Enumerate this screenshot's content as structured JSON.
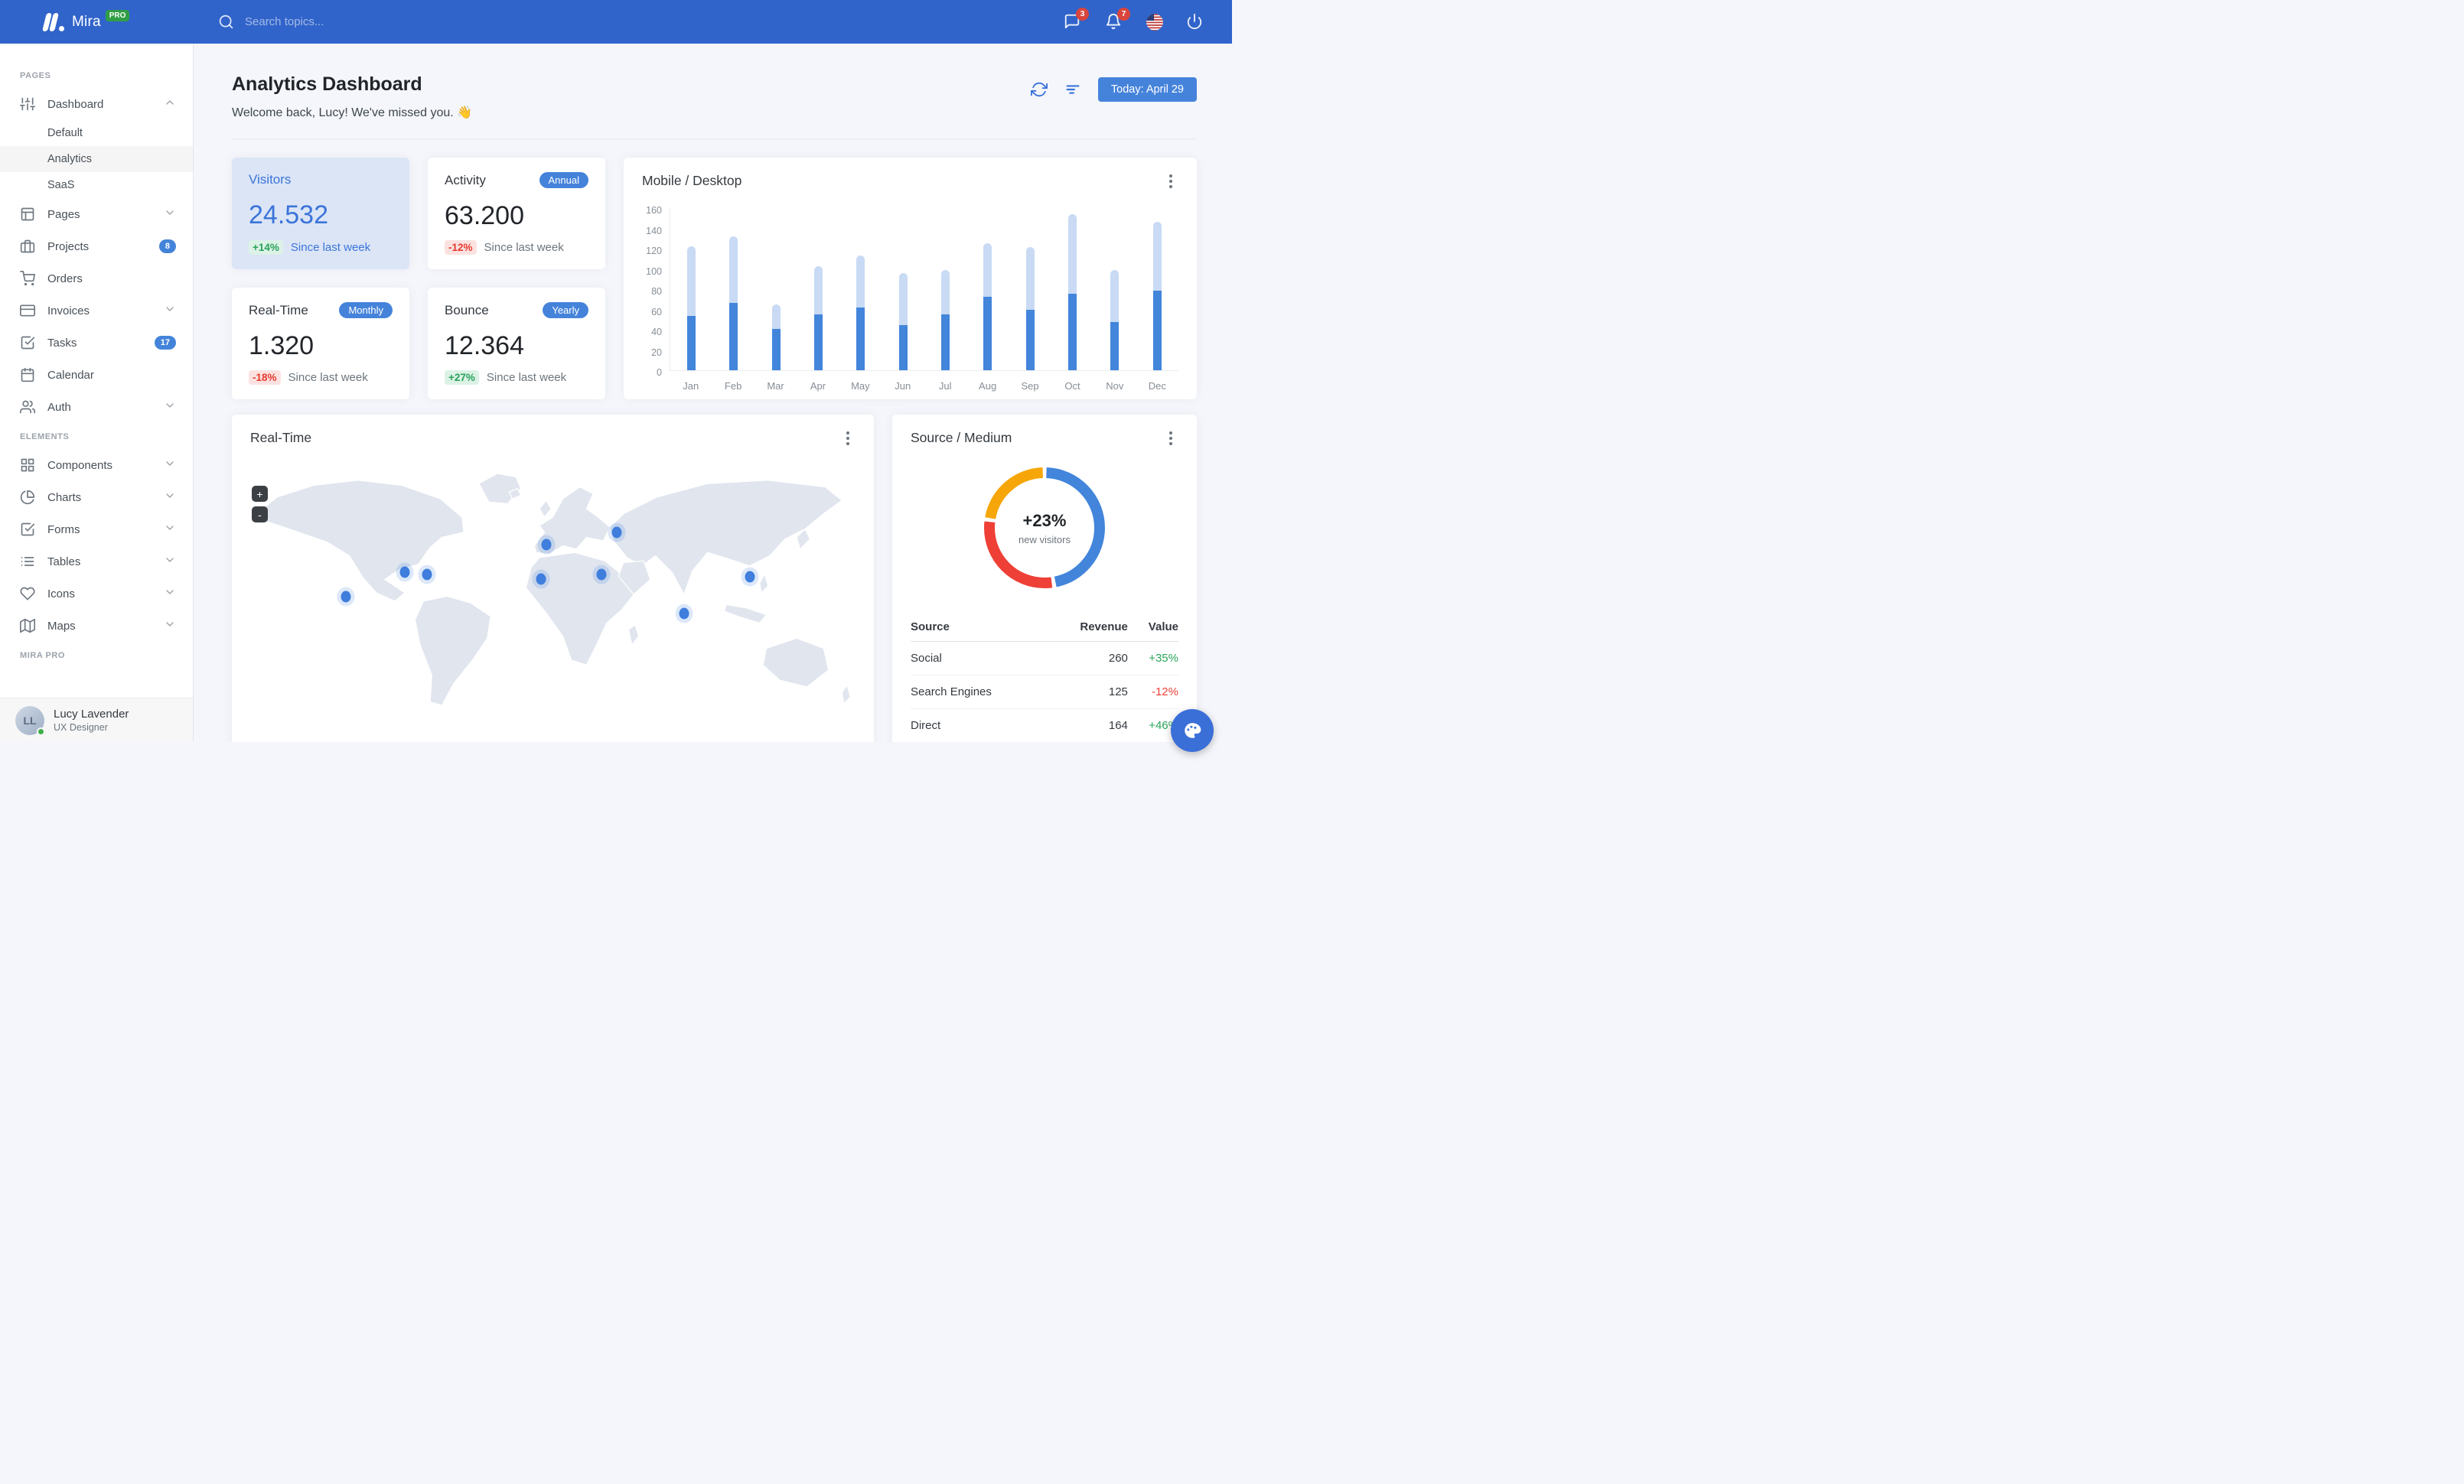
{
  "navbar": {
    "brand": "Mira",
    "brand_badge": "PRO",
    "search_placeholder": "Search topics...",
    "messages_badge": "3",
    "notifications_badge": "7"
  },
  "sidebar": {
    "sections": [
      {
        "header": "PAGES",
        "items": [
          {
            "label": "Dashboard"
          },
          {
            "label": "Default"
          },
          {
            "label": "Analytics"
          },
          {
            "label": "SaaS"
          },
          {
            "label": "Pages"
          },
          {
            "label": "Projects",
            "badge": "8"
          },
          {
            "label": "Orders"
          },
          {
            "label": "Invoices"
          },
          {
            "label": "Tasks",
            "badge": "17"
          },
          {
            "label": "Calendar"
          },
          {
            "label": "Auth"
          }
        ]
      },
      {
        "header": "ELEMENTS",
        "items": [
          {
            "label": "Components"
          },
          {
            "label": "Charts"
          },
          {
            "label": "Forms"
          },
          {
            "label": "Tables"
          },
          {
            "label": "Icons"
          },
          {
            "label": "Maps"
          }
        ]
      },
      {
        "header": "MIRA PRO",
        "items": []
      }
    ],
    "user": {
      "name": "Lucy Lavender",
      "role": "UX Designer",
      "initials": "LL"
    }
  },
  "header": {
    "title": "Analytics Dashboard",
    "subtitle": "Welcome back, Lucy! We've missed you. 👋",
    "date_button": "Today: April 29"
  },
  "stats": [
    {
      "title": "Visitors",
      "value": "24.532",
      "delta": "+14%",
      "note": "Since last week"
    },
    {
      "title": "Activity",
      "value": "63.200",
      "delta": "-12%",
      "note": "Since last week",
      "badge": "Annual"
    },
    {
      "title": "Real-Time",
      "value": "1.320",
      "delta": "-18%",
      "note": "Since last week",
      "badge": "Monthly"
    },
    {
      "title": "Bounce",
      "value": "12.364",
      "delta": "+27%",
      "note": "Since last week",
      "badge": "Yearly"
    }
  ],
  "chart_data": [
    {
      "type": "bar",
      "title": "Mobile / Desktop",
      "stacked": true,
      "categories": [
        "Jan",
        "Feb",
        "Mar",
        "Apr",
        "May",
        "Jun",
        "Jul",
        "Aug",
        "Sep",
        "Oct",
        "Nov",
        "Dec"
      ],
      "series": [
        {
          "name": "Mobile",
          "color": "#4285db",
          "values": [
            54,
            67,
            41,
            55,
            62,
            45,
            55,
            73,
            60,
            76,
            48,
            79
          ]
        },
        {
          "name": "Desktop",
          "color": "#c9daf4",
          "values": [
            69,
            66,
            24,
            48,
            52,
            51,
            44,
            53,
            62,
            79,
            51,
            68
          ]
        }
      ],
      "xlabel": "",
      "ylabel": "",
      "ylim": [
        0,
        160
      ],
      "ytick_step": 20,
      "grid": false,
      "legend": "none"
    },
    {
      "type": "donut",
      "title": "Source / Medium",
      "center_value": "+23%",
      "center_label": "new visitors",
      "slices": [
        {
          "label": "Social",
          "value": 260,
          "color": "#4285db"
        },
        {
          "label": "Direct",
          "value": 164,
          "color": "#ee4037"
        },
        {
          "label": "Search Engines",
          "value": 125,
          "color": "#f6a609"
        }
      ]
    }
  ],
  "map_card": {
    "title": "Real-Time",
    "zoom_in": "+",
    "zoom_out": "-",
    "markers": [
      {
        "city": "San Francisco",
        "x": 57,
        "y": 57
      },
      {
        "city": "Chicago",
        "x": 92,
        "y": 47
      },
      {
        "city": "New York",
        "x": 105,
        "y": 48
      },
      {
        "city": "London",
        "x": 176,
        "y": 36
      },
      {
        "city": "Madrid",
        "x": 173,
        "y": 50
      },
      {
        "city": "Moscow",
        "x": 218,
        "y": 31
      },
      {
        "city": "Istanbul",
        "x": 209,
        "y": 48
      },
      {
        "city": "Delhi",
        "x": 258,
        "y": 64
      },
      {
        "city": "Beijing",
        "x": 297,
        "y": 49
      }
    ]
  },
  "source_table": {
    "columns": [
      "Source",
      "Revenue",
      "Value"
    ],
    "rows": [
      {
        "source": "Social",
        "revenue": "260",
        "value": "+35%",
        "trend": "up"
      },
      {
        "source": "Search Engines",
        "revenue": "125",
        "value": "-12%",
        "trend": "down"
      },
      {
        "source": "Direct",
        "revenue": "164",
        "value": "+46%",
        "trend": "up"
      }
    ]
  }
}
